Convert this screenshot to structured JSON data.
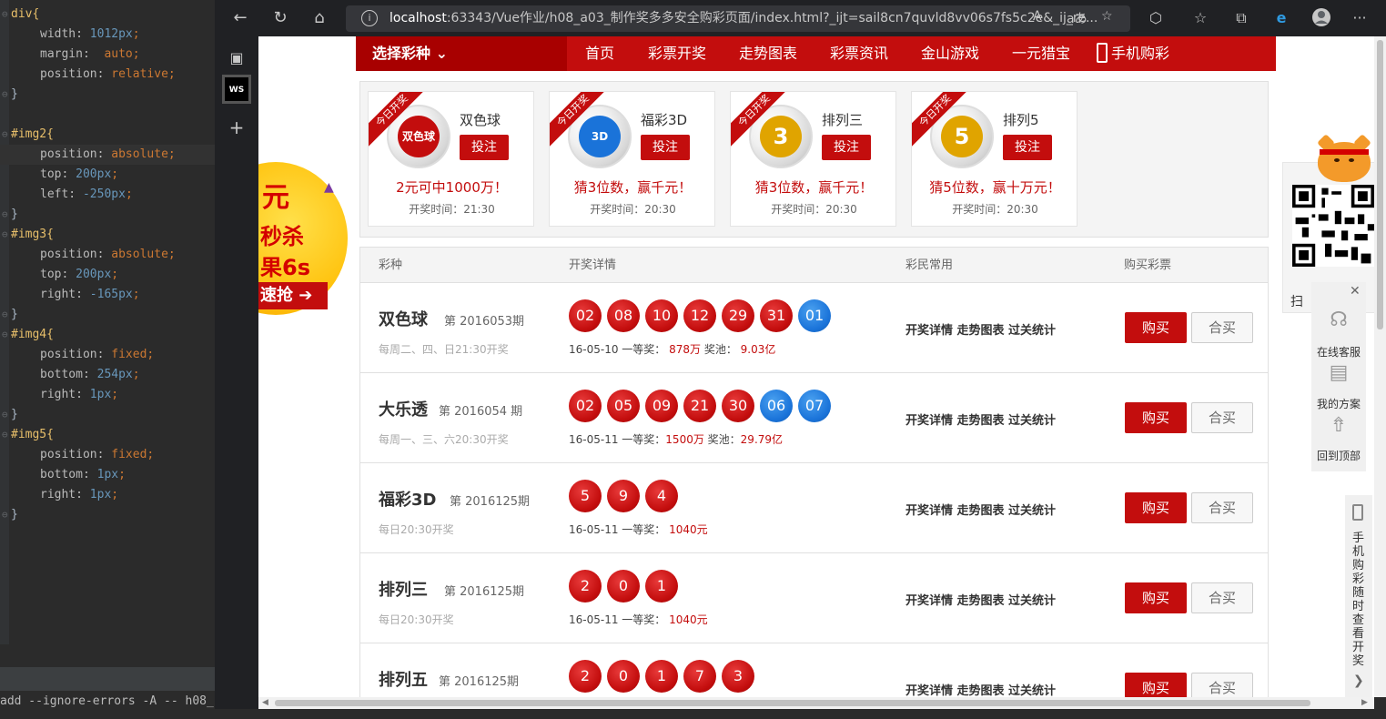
{
  "editor": {
    "lines": [
      {
        "sel": "div{",
        "kind": "open"
      },
      {
        "prop": "width",
        "val": "1012px",
        "vkind": "num"
      },
      {
        "prop": "margin",
        "val": "auto",
        "vkind": "kw",
        "sep": ":  "
      },
      {
        "prop": "position",
        "val": "relative",
        "vkind": "kw"
      },
      {
        "sel": "}",
        "kind": "close"
      },
      {
        "blank": true
      },
      {
        "sel": "#img2{",
        "kind": "open"
      },
      {
        "prop": "position",
        "val": "absolute",
        "vkind": "kw",
        "hl": true
      },
      {
        "prop": "top",
        "val": "200px",
        "vkind": "num"
      },
      {
        "prop": "left",
        "val": "-250px",
        "vkind": "num"
      },
      {
        "sel": "}",
        "kind": "close"
      },
      {
        "sel": "#img3{",
        "kind": "open"
      },
      {
        "prop": "position",
        "val": "absolute",
        "vkind": "kw"
      },
      {
        "prop": "top",
        "val": "200px",
        "vkind": "num"
      },
      {
        "prop": "right",
        "val": "-165px",
        "vkind": "num"
      },
      {
        "sel": "}",
        "kind": "close"
      },
      {
        "sel": "#img4{",
        "kind": "open"
      },
      {
        "prop": "position",
        "val": "fixed",
        "vkind": "kw"
      },
      {
        "prop": "bottom",
        "val": "254px",
        "vkind": "num"
      },
      {
        "prop": "right",
        "val": "1px",
        "vkind": "num"
      },
      {
        "sel": "}",
        "kind": "close"
      },
      {
        "sel": "#img5{",
        "kind": "open"
      },
      {
        "prop": "position",
        "val": "fixed",
        "vkind": "kw"
      },
      {
        "prop": "bottom",
        "val": "1px",
        "vkind": "num"
      },
      {
        "prop": "right",
        "val": "1px",
        "vkind": "num"
      },
      {
        "sel": "}",
        "kind": "close"
      }
    ],
    "terminal_text": "add --ignore-errors -A -- h08_"
  },
  "browser": {
    "url_host": "localhost",
    "url_rest": ":63343/Vue作业/h08_a03_制作奖多多安全购彩页面/index.html?_ijt=sail8cn7quvld8vv06s7fs5c2e&_ij_re...",
    "read_aloud_label": "A",
    "translate_label": "aあ"
  },
  "nav": {
    "select_label": "选择彩种",
    "items": [
      "首页",
      "彩票开奖",
      "走势图表",
      "彩票资讯",
      "金山游戏",
      "一元猎宝",
      "手机购彩"
    ]
  },
  "cards": [
    {
      "ribbon": "今日开奖",
      "name": "双色球",
      "bet": "投注",
      "slogan": "2元可中1000万！",
      "time": "开奖时间：21:30",
      "logo_color": "#c30d0d",
      "logo_text": "双色球"
    },
    {
      "ribbon": "今日开奖",
      "name": "福彩3D",
      "bet": "投注",
      "slogan": "猜3位数，赢千元！",
      "time": "开奖时间：20:30",
      "logo_color": "#1a73d9",
      "logo_text": "3D"
    },
    {
      "ribbon": "今日开奖",
      "name": "排列三",
      "bet": "投注",
      "slogan": "猜3位数，赢千元！",
      "time": "开奖时间：20:30",
      "logo_color": "#e0a400",
      "logo_text": "3"
    },
    {
      "ribbon": "今日开奖",
      "name": "排列5",
      "bet": "投注",
      "slogan": "猜5位数，赢十万元！",
      "time": "开奖时间：20:30",
      "logo_color": "#e0a400",
      "logo_text": "5"
    }
  ],
  "table": {
    "headers": [
      "彩种",
      "开奖详情",
      "彩民常用",
      "购买彩票"
    ],
    "rows": [
      {
        "name": "双色球",
        "issue": "第 2016053期",
        "sched": "每周二、四、日21:30开奖",
        "balls": [
          {
            "n": "02",
            "c": "red"
          },
          {
            "n": "08",
            "c": "red"
          },
          {
            "n": "10",
            "c": "red"
          },
          {
            "n": "12",
            "c": "red"
          },
          {
            "n": "29",
            "c": "red"
          },
          {
            "n": "31",
            "c": "red"
          },
          {
            "n": "01",
            "c": "blue"
          }
        ],
        "prize_pre": "16-05-10 一等奖：",
        "prize_amt": " 878万",
        "pool_pre": " 奖池：",
        "pool_amt": " 9.03亿",
        "links": "开奖详情 走势图表 过关统计",
        "buy": "购买",
        "joint": "合买"
      },
      {
        "name": "大乐透",
        "issue": "第 2016054 期",
        "sched": "每周一、三、六20:30开奖",
        "balls": [
          {
            "n": "02",
            "c": "red"
          },
          {
            "n": "05",
            "c": "red"
          },
          {
            "n": "09",
            "c": "red"
          },
          {
            "n": "21",
            "c": "red"
          },
          {
            "n": "30",
            "c": "red"
          },
          {
            "n": "06",
            "c": "blue"
          },
          {
            "n": "07",
            "c": "blue"
          }
        ],
        "prize_pre": "16-05-11 一等奖：",
        "prize_amt": "1500万",
        "pool_pre": " 奖池：",
        "pool_amt": "29.79亿",
        "links": "开奖详情 走势图表 过关统计",
        "buy": "购买",
        "joint": "合买"
      },
      {
        "name": "福彩3D",
        "issue": "第 2016125期",
        "sched": "每日20:30开奖",
        "balls": [
          {
            "n": "5",
            "c": "red"
          },
          {
            "n": "9",
            "c": "red"
          },
          {
            "n": "4",
            "c": "red"
          }
        ],
        "prize_pre": "16-05-11 一等奖：",
        "prize_amt": " 1040元",
        "pool_pre": "",
        "pool_amt": "",
        "links": "开奖详情 走势图表 过关统计",
        "buy": "购买",
        "joint": "合买"
      },
      {
        "name": "排列三",
        "issue": "第 2016125期",
        "sched": "每日20:30开奖",
        "balls": [
          {
            "n": "2",
            "c": "red"
          },
          {
            "n": "0",
            "c": "red"
          },
          {
            "n": "1",
            "c": "red"
          }
        ],
        "prize_pre": "16-05-11 一等奖：",
        "prize_amt": " 1040元",
        "pool_pre": "",
        "pool_amt": "",
        "links": "开奖详情 走势图表 过关统计",
        "buy": "购买",
        "joint": "合买"
      },
      {
        "name": "排列五",
        "issue": "第 2016125期",
        "sched": "",
        "balls": [
          {
            "n": "2",
            "c": "red"
          },
          {
            "n": "0",
            "c": "red"
          },
          {
            "n": "1",
            "c": "red"
          },
          {
            "n": "7",
            "c": "red"
          },
          {
            "n": "3",
            "c": "red"
          }
        ],
        "prize_pre": "",
        "prize_amt": "",
        "pool_pre": "",
        "pool_amt": "",
        "links": "开奖详情 走势图表 过关统计",
        "buy": "购买",
        "joint": "合买"
      }
    ]
  },
  "ad_left": {
    "t1": "元",
    "t2": "秒杀",
    "t3": "果6s",
    "t4": "速抢"
  },
  "qr": {
    "label": "扫"
  },
  "service": {
    "items": [
      "在线客服",
      "我的方案",
      "回到顶部"
    ],
    "close": "✕"
  },
  "mobile_tab": {
    "text": "手机购彩随时查看开奖"
  },
  "colors": {
    "brand_red": "#c30d0d",
    "ball_blue": "#1a73d9"
  }
}
